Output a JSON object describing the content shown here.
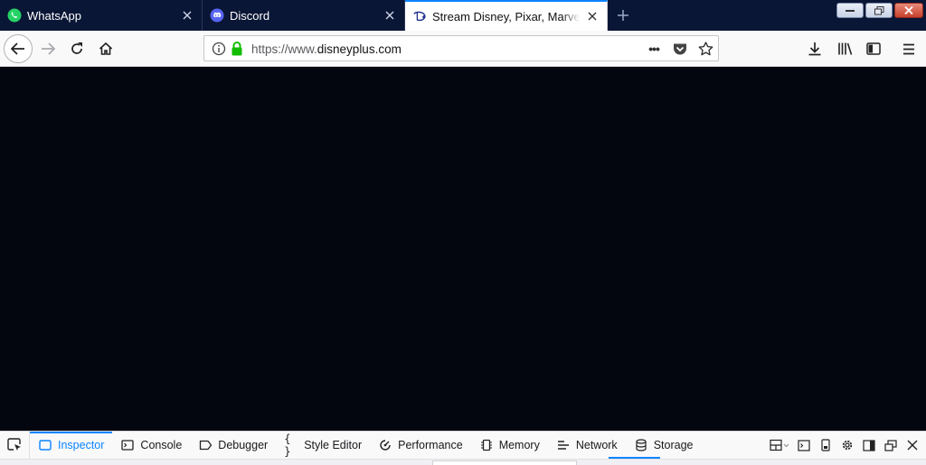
{
  "tabs": [
    {
      "title": "WhatsApp",
      "icon": "whatsapp-icon",
      "active": false
    },
    {
      "title": "Discord",
      "icon": "discord-icon",
      "active": false
    },
    {
      "title": "Stream Disney, Pixar, Marvel, Star Wars",
      "icon": "disney-icon",
      "active": true
    }
  ],
  "address_bar": {
    "url_prefix": "https://www.",
    "url_domain": "disneyplus.com",
    "page_actions_glyph": "•••"
  },
  "devtools": {
    "tabs": [
      {
        "label": "Inspector",
        "icon": "inspector-icon",
        "active": true
      },
      {
        "label": "Console",
        "icon": "console-icon"
      },
      {
        "label": "Debugger",
        "icon": "debugger-icon"
      },
      {
        "label": "Style Editor",
        "icon": "style-editor-icon"
      },
      {
        "label": "Performance",
        "icon": "performance-icon"
      },
      {
        "label": "Memory",
        "icon": "memory-icon"
      },
      {
        "label": "Network",
        "icon": "network-icon"
      },
      {
        "label": "Storage",
        "icon": "storage-icon"
      }
    ]
  },
  "colors": {
    "tabstrip_bg": "#0a1636",
    "accent": "#0a84ff",
    "content_bg": "#03050f",
    "lock_green": "#12bc00"
  }
}
